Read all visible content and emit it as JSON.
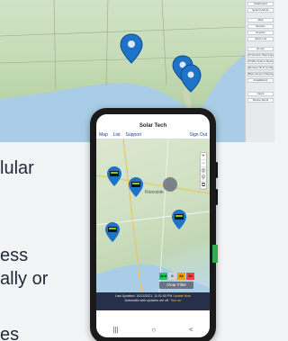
{
  "desktop_sidebar": {
    "items": [
      "Dashboard",
      "Search Admin",
      "",
      "Map",
      "Reports",
      "Exports",
      "Alerts List",
      "",
      "Hi-Lite",
      "Production Warnings",
      "Profile System Report",
      "Remote Wi-Fi Config",
      "Beta Account Status",
      "Installations",
      "",
      "",
      "Users",
      "Device Alerts"
    ]
  },
  "slide_fragments": {
    "line1": "lular",
    "line2": "ess",
    "line3": "ally or",
    "line4": "es"
  },
  "phone": {
    "app_title": "Solar Tech",
    "nav": {
      "map": "Map",
      "list": "List",
      "support": "Support",
      "signout": "Sign Out"
    },
    "map": {
      "city_label": "Riverside",
      "controls": [
        "+",
        "−",
        "◎",
        "⚲",
        "⧉"
      ]
    },
    "legend": [
      {
        "label": "2nd",
        "color": "#22c55e"
      },
      {
        "label": "0",
        "color": "#d1d5db"
      },
      {
        "label": "2k",
        "color": "#f59e0b"
      },
      {
        "label": "1h",
        "color": "#ef4444"
      }
    ],
    "clear_filter_label": "Clear Filter",
    "footer": {
      "line1": "Last Updated: 10/11/2021, 11:01:00 PM",
      "updates": "Update Now",
      "line2": "Automatic web updates are off.",
      "enable": "Turn on"
    },
    "sysbar": {
      "back": "|||",
      "home": "○",
      "recent": "<"
    }
  },
  "colors": {
    "pin": "#1e73c8",
    "nav": "#1c3d8f",
    "footer_bg": "#27304a"
  }
}
